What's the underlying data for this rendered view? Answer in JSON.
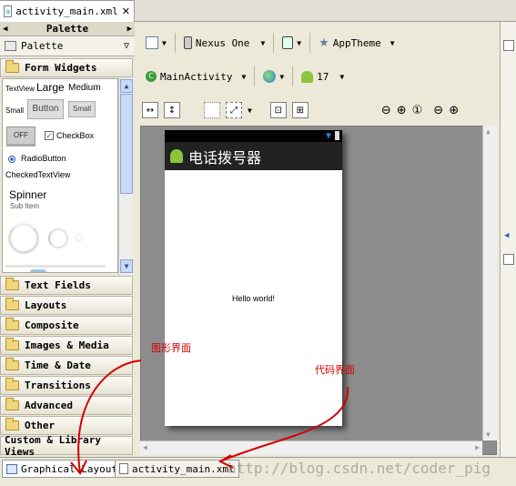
{
  "editor_tab": {
    "label": "activity_main.xml",
    "close": "✕"
  },
  "palette": {
    "title": "Palette",
    "header": "Palette",
    "open_category": "Form Widgets",
    "categories": [
      "Text Fields",
      "Layouts",
      "Composite",
      "Images & Media",
      "Time & Date",
      "Transitions",
      "Advanced",
      "Other"
    ],
    "custom_views": "Custom & Library Views",
    "widgets": {
      "textview": "TextView",
      "large": "Large",
      "medium": "Medium",
      "small": "Small",
      "button": "Button",
      "small_button": "Small",
      "toggle": "OFF",
      "checkbox": "CheckBox",
      "radio": "RadioButton",
      "checked_textview": "CheckedTextView",
      "spinner": "Spinner",
      "sub_item": "Sub Item"
    }
  },
  "toolbar": {
    "device": "Nexus One",
    "theme": "AppTheme",
    "activity": "MainActivity",
    "api": "17"
  },
  "preview": {
    "app_title": "电话拨号器",
    "hello": "Hello world!"
  },
  "bottom_tabs": {
    "graphical": "Graphical Layout",
    "xml": "activity_main.xml"
  },
  "annotations": {
    "graphical": "图形界面",
    "code": "代码界面"
  },
  "watermark": "http://blog.csdn.net/coder_pig",
  "colors": {
    "annotation": "#d40000",
    "canvas": "#8d8d8d",
    "action_bar": "#222222"
  }
}
